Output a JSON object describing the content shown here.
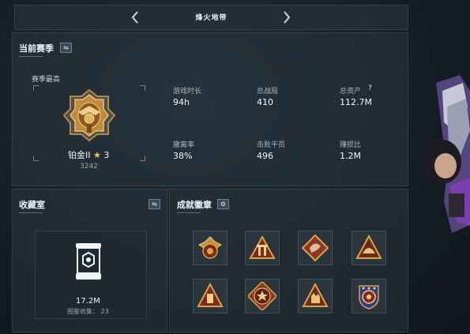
{
  "header": {
    "mode_title": "烽火地带"
  },
  "season": {
    "title": "当前赛季",
    "best_label": "赛季最高",
    "rank_name": "铂金II",
    "rank_stars": "3",
    "rank_points": "3242",
    "stats": [
      {
        "label": "游戏时长",
        "value": "94h"
      },
      {
        "label": "总战局",
        "value": "410"
      },
      {
        "label": "总资产",
        "value": "112.7M"
      },
      {
        "label": "撤离率",
        "value": "38%"
      },
      {
        "label": "击败干员",
        "value": "496"
      },
      {
        "label": "赚损比",
        "value": "1.2M"
      }
    ],
    "asset_help": "?"
  },
  "collection": {
    "title": "收藏室",
    "value": "17.2M",
    "count_label": "图鉴收集：",
    "count_value": "23"
  },
  "achievements": {
    "title": "成就徽章",
    "badges": [
      "eagle-crest",
      "gate-triangle",
      "diamond-dragon",
      "helmet-triangle",
      "bar-triangle",
      "star-emblem",
      "hand-triangle",
      "shield-crest"
    ]
  },
  "colors": {
    "accent_gold": "#d9a441",
    "badge_red": "#7a2a1e",
    "panel_bg": "#28343e"
  }
}
